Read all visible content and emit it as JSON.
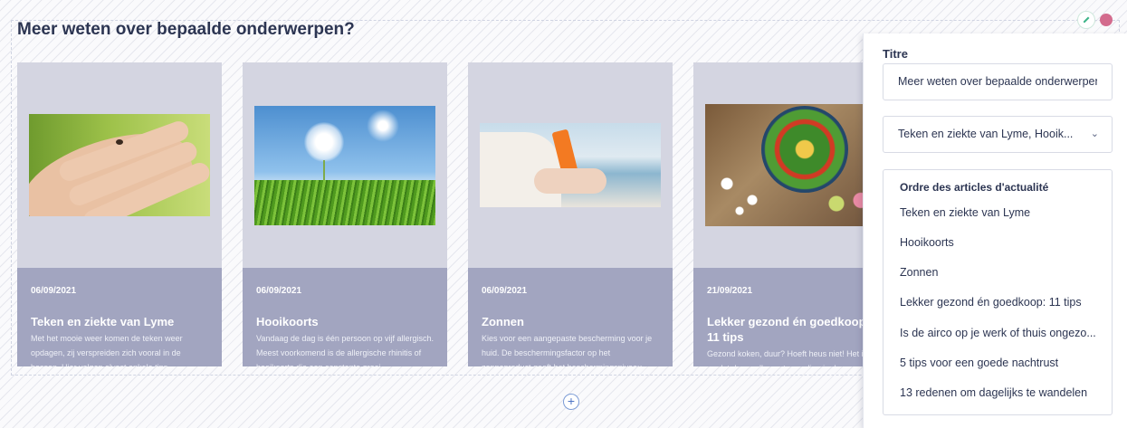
{
  "section": {
    "title": "Meer weten over bepaalde onderwerpen?"
  },
  "cards": [
    {
      "date": "06/09/2021",
      "title": "Teken en ziekte van Lyme",
      "description": "Met het mooie weer komen de teken weer opdagen, zij verspreiden zich vooral in de bossen. Hier volgen alvast enkele tips"
    },
    {
      "date": "06/09/2021",
      "title": "Hooikoorts",
      "description": "Vandaag de dag is één persoon op vijf allergisch. Meest voorkomend is de allergische rhinitis of hooikoorts die een constante groei"
    },
    {
      "date": "06/09/2021",
      "title": "Zonnen",
      "description": "Kies voor een aangepaste bescherming voor je huid. De beschermingsfactor op het zonneproduct geeft het beschermingsniveau"
    },
    {
      "date": "21/09/2021",
      "title": "Lekker gezond én goedkoop: 11 tips",
      "description": "Gezond koken, duur? Hoeft heus niet! Het is niet omdat de goedkoopste voeding in de"
    }
  ],
  "panel": {
    "title_label": "Titre",
    "title_value": "Meer weten over bepaalde onderwerpen?",
    "select_value": "Teken en ziekte van Lyme, Hooik...",
    "order_heading": "Ordre des articles d'actualité",
    "order_items": [
      "Teken en ziekte van Lyme",
      "Hooikoorts",
      "Zonnen",
      "Lekker gezond én goedkoop: 11 tips",
      "Is de airco op je werk of thuis ongezo...",
      "5 tips voor een goede nachtrust",
      "13 redenen om dagelijks te wandelen"
    ]
  },
  "controls": {
    "add_symbol": "+",
    "edit_icon": "pencil-icon",
    "status_color": "#d36b8d"
  }
}
